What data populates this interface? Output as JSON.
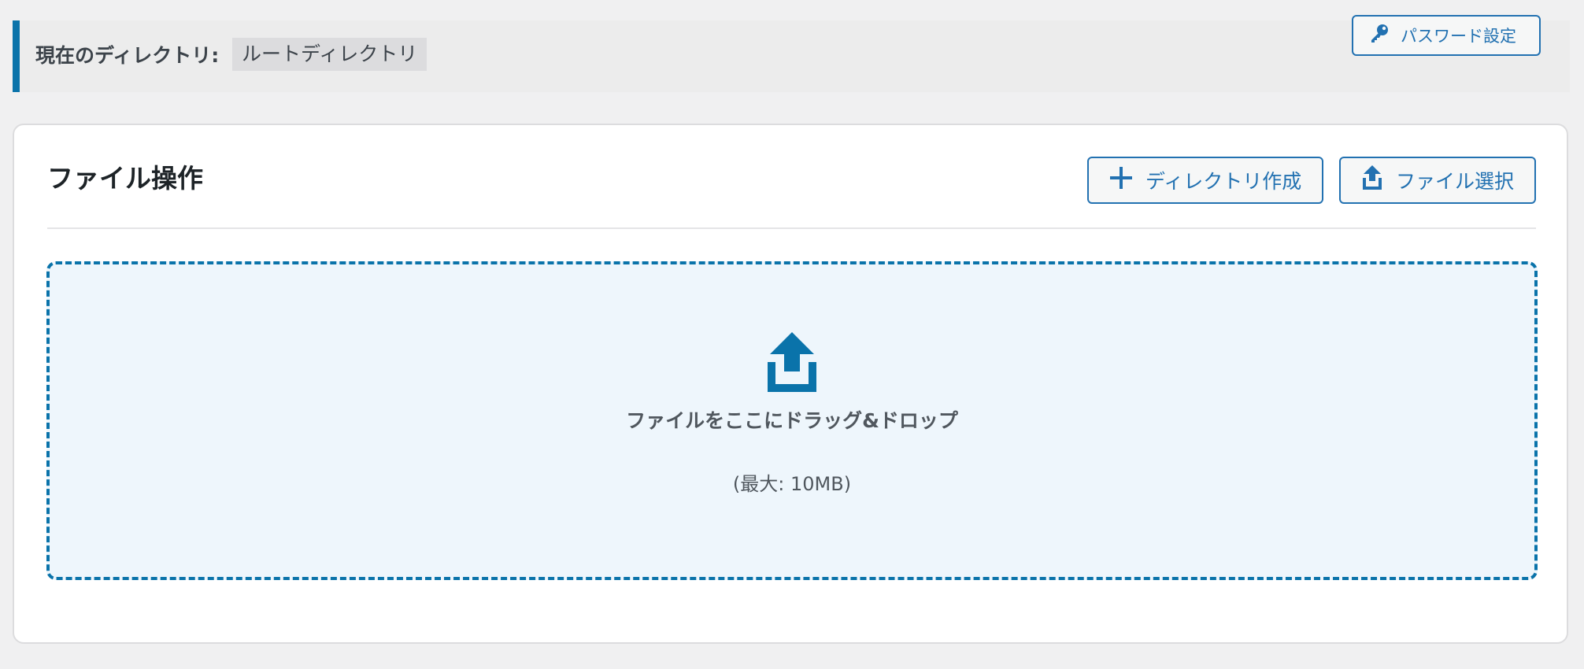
{
  "directory": {
    "label": "現在のディレクトリ:",
    "value": "ルートディレクトリ"
  },
  "header_actions": {
    "password_button": {
      "label": "パスワード設定",
      "icon": "key-icon"
    }
  },
  "file_operations": {
    "title": "ファイル操作",
    "buttons": [
      {
        "label": "ディレクトリ作成",
        "icon": "plus-icon"
      },
      {
        "label": "ファイル選択",
        "icon": "upload-icon"
      }
    ],
    "dropzone": {
      "icon": "upload-icon",
      "text": "ファイルをここにドラッグ&ドロップ",
      "hint": "(最大: 10MB)"
    }
  },
  "colors": {
    "accent": "#0a73aa",
    "button_text": "#2271b1",
    "dropzone_bg": "#eef6fc",
    "page_bg": "#f0f0f1"
  }
}
